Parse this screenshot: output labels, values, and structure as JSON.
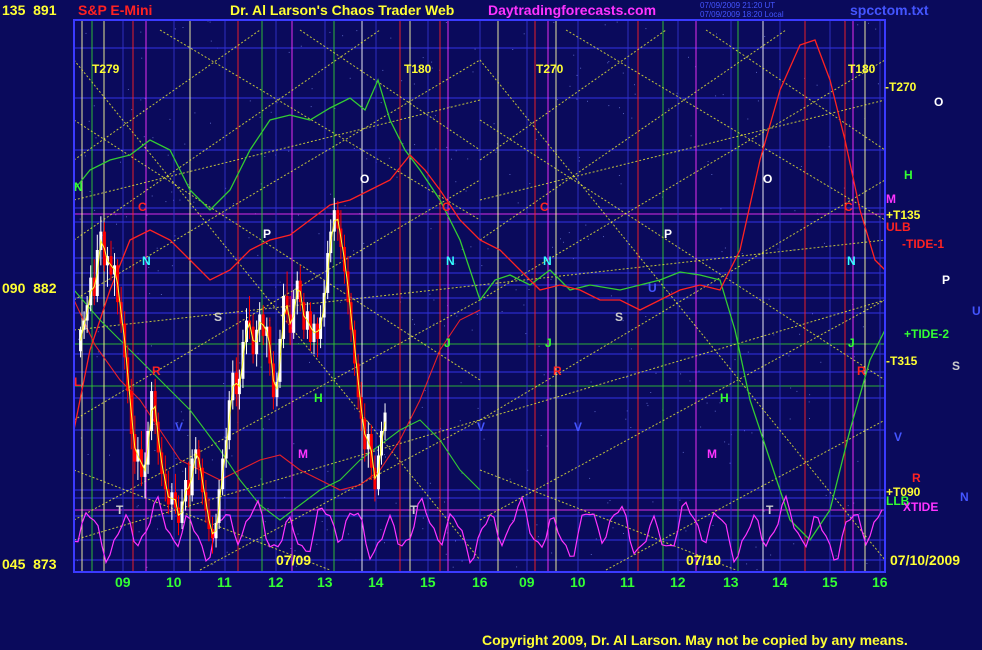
{
  "header": {
    "symbol": "S&P E-Mini",
    "title": "Dr. Al Larson's Chaos Trader Web",
    "site": "Daytradingforecasts.com",
    "timestamp_1": "07/09/2009 21:20 UT",
    "timestamp_2": "07/09/2009 18:20 Local",
    "file": "spcctom.txt"
  },
  "y_axis": {
    "top": {
      "left": "135",
      "price": "891"
    },
    "mid": {
      "left": "090",
      "price": "882"
    },
    "bottom": {
      "left": "045",
      "price": "873"
    }
  },
  "x_axis": {
    "hours": [
      "09",
      "10",
      "11",
      "12",
      "13",
      "14",
      "15",
      "16",
      "09",
      "10",
      "11",
      "12",
      "13",
      "14",
      "15",
      "16"
    ],
    "date_labels": [
      "07/09",
      "07/10",
      "07/10/2009"
    ]
  },
  "markers": {
    "t279": "T279",
    "t180a": "T180",
    "t270": "T270",
    "t180b": "T180",
    "minus_t270": "-T270",
    "plus_t135": "+T135",
    "ulb": "ULB",
    "minus_tide1": "-TIDE-1",
    "plus_tide2": "+TIDE-2",
    "minus_t315": "-T315",
    "plus_t090": "+T090",
    "llb": "LLB",
    "xtide": "XTIDE",
    "o": "O",
    "h": "H",
    "m": "M",
    "p": "P",
    "u": "U",
    "s": "S",
    "v": "V",
    "r": "R",
    "n": "N",
    "j": "J",
    "c": "C",
    "t": "T",
    "l": "L"
  },
  "copyright": "Copyright 2009, Dr. Al Larson. May not be copied by any means.",
  "colors": {
    "background": "#0a0a5c",
    "grid": "#3333cc",
    "price_up": "#ffffff",
    "price_down": "#ff0000",
    "green_flux": "#33cc33",
    "red_flux": "#ff2222",
    "magenta_flux": "#ff33ff",
    "yellow": "#ffff33"
  },
  "chart_data": {
    "type": "candlestick",
    "title": "S&P E-Mini",
    "x_domain_hours": [
      8.3,
      16
    ],
    "y_range_price": [
      873,
      891
    ],
    "candles": [
      [
        8.05,
        880.2,
        881.0,
        880.0,
        880.9
      ],
      [
        8.12,
        880.9,
        881.5,
        880.6,
        881.2
      ],
      [
        8.18,
        881.2,
        882.0,
        880.8,
        881.7
      ],
      [
        8.25,
        881.7,
        883.0,
        881.5,
        882.6
      ],
      [
        8.32,
        882.6,
        883.2,
        881.7,
        882.0
      ],
      [
        8.38,
        882.0,
        884.0,
        881.8,
        883.5
      ],
      [
        8.45,
        883.5,
        884.6,
        883.0,
        884.1
      ],
      [
        8.52,
        884.1,
        884.4,
        882.8,
        883.0
      ],
      [
        8.58,
        883.0,
        883.6,
        882.3,
        883.3
      ],
      [
        8.65,
        883.3,
        883.8,
        882.5,
        882.7
      ],
      [
        8.72,
        882.7,
        883.4,
        882.0,
        883.0
      ],
      [
        8.78,
        883.0,
        883.2,
        881.4,
        881.8
      ],
      [
        8.85,
        881.8,
        882.3,
        880.8,
        881.1
      ],
      [
        8.92,
        881.1,
        881.5,
        879.6,
        880.0
      ],
      [
        8.98,
        880.0,
        880.4,
        878.5,
        878.9
      ],
      [
        9.05,
        878.9,
        879.3,
        877.0,
        877.5
      ],
      [
        9.12,
        877.5,
        878.1,
        876.2,
        876.6
      ],
      [
        9.18,
        876.6,
        877.4,
        876.0,
        877.0
      ],
      [
        9.25,
        877.0,
        877.6,
        875.8,
        876.1
      ],
      [
        9.32,
        876.1,
        876.9,
        875.4,
        876.5
      ],
      [
        9.38,
        876.5,
        877.9,
        876.2,
        877.6
      ],
      [
        9.45,
        877.6,
        879.2,
        877.3,
        878.9
      ],
      [
        9.52,
        878.9,
        879.3,
        877.5,
        877.9
      ],
      [
        9.58,
        877.9,
        878.2,
        876.5,
        876.9
      ],
      [
        9.65,
        876.9,
        877.4,
        875.8,
        876.2
      ],
      [
        9.72,
        876.2,
        876.8,
        875.3,
        875.7
      ],
      [
        9.78,
        875.7,
        876.3,
        874.9,
        875.2
      ],
      [
        9.85,
        875.2,
        875.9,
        874.7,
        875.6
      ],
      [
        9.92,
        875.6,
        876.2,
        874.9,
        875.1
      ],
      [
        9.98,
        875.1,
        875.5,
        874.2,
        874.6
      ],
      [
        10.05,
        874.6,
        875.7,
        874.4,
        875.3
      ],
      [
        10.12,
        875.3,
        876.4,
        875.0,
        876.0
      ],
      [
        10.18,
        876.0,
        876.6,
        875.1,
        875.5
      ],
      [
        10.25,
        875.5,
        877.0,
        875.3,
        876.7
      ],
      [
        10.32,
        876.7,
        877.4,
        876.2,
        877.0
      ],
      [
        10.38,
        877.0,
        877.3,
        876.0,
        876.4
      ],
      [
        10.45,
        876.4,
        876.7,
        875.2,
        875.6
      ],
      [
        10.52,
        875.6,
        876.0,
        874.6,
        875.0
      ],
      [
        10.58,
        875.0,
        875.4,
        874.0,
        874.4
      ],
      [
        10.65,
        874.4,
        874.8,
        873.6,
        874.1
      ],
      [
        10.72,
        874.1,
        874.9,
        873.8,
        874.6
      ],
      [
        10.78,
        874.6,
        876.0,
        874.4,
        875.7
      ],
      [
        10.85,
        875.7,
        877.0,
        875.5,
        876.7
      ],
      [
        10.92,
        876.7,
        877.7,
        876.4,
        877.3
      ],
      [
        10.98,
        877.3,
        878.9,
        877.0,
        878.6
      ],
      [
        11.05,
        878.6,
        879.9,
        878.3,
        879.5
      ],
      [
        11.12,
        879.5,
        880.0,
        878.4,
        878.8
      ],
      [
        11.18,
        878.8,
        879.6,
        878.3,
        879.3
      ],
      [
        11.25,
        879.3,
        880.9,
        879.0,
        880.5
      ],
      [
        11.32,
        880.5,
        881.6,
        880.1,
        881.2
      ],
      [
        11.38,
        881.2,
        882.0,
        880.6,
        881.0
      ],
      [
        11.45,
        881.0,
        881.4,
        879.8,
        880.1
      ],
      [
        11.52,
        880.1,
        881.2,
        879.7,
        880.9
      ],
      [
        11.58,
        880.9,
        881.8,
        880.5,
        881.4
      ],
      [
        11.65,
        881.4,
        881.7,
        880.4,
        880.7
      ],
      [
        11.72,
        880.7,
        881.3,
        880.0,
        881.0
      ],
      [
        11.78,
        881.0,
        881.3,
        879.4,
        879.8
      ],
      [
        11.85,
        879.8,
        880.2,
        878.3,
        878.7
      ],
      [
        11.92,
        878.7,
        879.5,
        878.4,
        879.2
      ],
      [
        11.98,
        879.2,
        880.9,
        879.0,
        880.6
      ],
      [
        12.05,
        880.6,
        882.4,
        880.3,
        882.0
      ],
      [
        12.12,
        882.0,
        882.8,
        881.1,
        881.4
      ],
      [
        12.18,
        881.4,
        882.0,
        880.4,
        880.8
      ],
      [
        12.25,
        880.8,
        882.2,
        880.6,
        881.9
      ],
      [
        12.32,
        881.9,
        882.8,
        881.4,
        882.5
      ],
      [
        12.38,
        882.5,
        883.0,
        881.5,
        881.8
      ],
      [
        12.45,
        881.8,
        882.1,
        880.6,
        880.9
      ],
      [
        12.52,
        880.9,
        881.8,
        880.6,
        881.5
      ],
      [
        12.58,
        881.5,
        881.8,
        880.2,
        880.5
      ],
      [
        12.65,
        880.5,
        881.4,
        880.1,
        881.1
      ],
      [
        12.72,
        881.1,
        881.3,
        880.0,
        880.6
      ],
      [
        12.78,
        880.6,
        881.7,
        880.3,
        881.3
      ],
      [
        12.85,
        881.3,
        882.5,
        881.0,
        882.1
      ],
      [
        12.92,
        882.1,
        883.8,
        881.9,
        883.4
      ],
      [
        12.98,
        883.4,
        884.5,
        883.1,
        884.1
      ],
      [
        13.05,
        884.1,
        885.2,
        883.8,
        884.8
      ],
      [
        13.12,
        884.8,
        885.1,
        883.8,
        884.2
      ],
      [
        13.18,
        884.2,
        884.8,
        883.2,
        883.6
      ],
      [
        13.25,
        883.6,
        884.0,
        882.4,
        882.8
      ],
      [
        13.32,
        882.8,
        883.3,
        881.4,
        881.8
      ],
      [
        13.38,
        881.8,
        882.1,
        880.5,
        880.9
      ],
      [
        13.45,
        880.9,
        881.2,
        879.4,
        879.8
      ],
      [
        13.52,
        879.8,
        880.1,
        878.3,
        878.7
      ],
      [
        13.58,
        878.7,
        879.2,
        877.6,
        878.0
      ],
      [
        13.65,
        878.0,
        878.5,
        876.6,
        877.0
      ],
      [
        13.72,
        877.0,
        877.9,
        876.4,
        877.5
      ],
      [
        13.78,
        877.5,
        877.8,
        876.0,
        876.4
      ],
      [
        13.85,
        876.4,
        876.8,
        875.3,
        875.7
      ],
      [
        13.92,
        875.7,
        877.1,
        875.5,
        876.8
      ],
      [
        13.98,
        876.8,
        877.9,
        876.5,
        877.6
      ],
      [
        14.05,
        877.6,
        878.5,
        877.3,
        878.2
      ]
    ]
  }
}
